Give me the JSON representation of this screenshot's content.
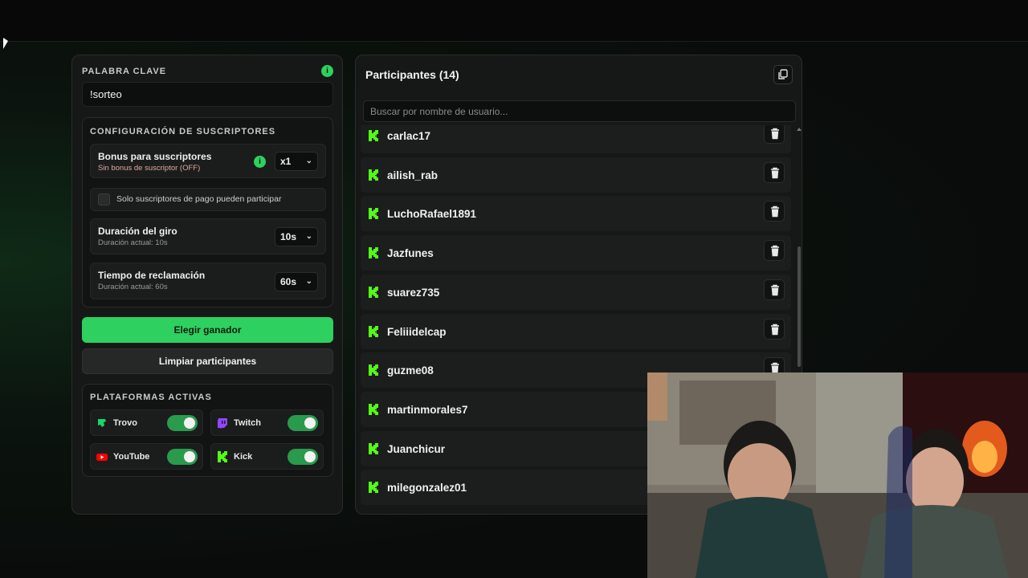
{
  "keyword": {
    "title": "PALABRA CLAVE",
    "info_icon": "info-icon",
    "value": "!sorteo"
  },
  "subscribers": {
    "title": "CONFIGURACIÓN DE SUSCRIPTORES",
    "bonus": {
      "label": "Bonus para suscriptores",
      "status": "Sin bonus de suscriptor (OFF)",
      "selected": "x1"
    },
    "paid_only": {
      "label": "Solo suscriptores de pago pueden participar",
      "checked": false
    },
    "spin_duration": {
      "label": "Duración del giro",
      "sub": "Duración actual: 10s",
      "selected": "10s"
    },
    "claim_time": {
      "label": "Tiempo de reclamación",
      "sub": "Duración actual: 60s",
      "selected": "60s"
    }
  },
  "actions": {
    "pick_winner": "Elegir ganador",
    "clear": "Limpiar participantes"
  },
  "platforms": {
    "title": "PLATAFORMAS ACTIVAS",
    "items": [
      {
        "name": "Trovo",
        "icon": "trovo-icon",
        "color": "#19d66b",
        "enabled": true
      },
      {
        "name": "Twitch",
        "icon": "twitch-icon",
        "color": "#9146ff",
        "enabled": true
      },
      {
        "name": "YouTube",
        "icon": "youtube-icon",
        "color": "#ff0000",
        "enabled": true
      },
      {
        "name": "Kick",
        "icon": "kick-icon",
        "color": "#53fc18",
        "enabled": true
      }
    ]
  },
  "participants": {
    "title": "Participantes (14)",
    "search_placeholder": "Buscar por nombre de usuario...",
    "users": [
      "carlac17",
      "ailish_rab",
      "LuchoRafael1891",
      "Jazfunes",
      "suarez735",
      "Feliiidelcap",
      "guzme08",
      "martinmorales7",
      "Juanchicur",
      "milegonzalez01"
    ]
  },
  "colors": {
    "accent": "#2ed160",
    "kick": "#53fc18"
  }
}
